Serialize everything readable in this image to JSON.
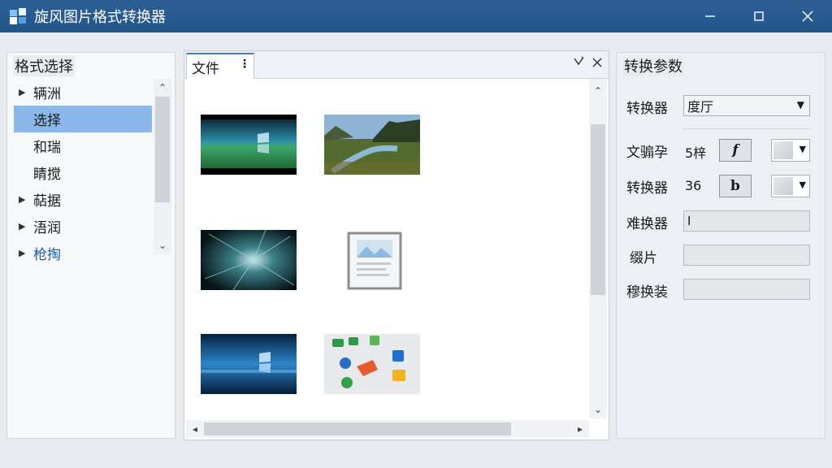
{
  "window": {
    "title": "旋风图片格式转换器",
    "controls": [
      "minimize",
      "maximize",
      "close"
    ]
  },
  "left_panel": {
    "title": "格式选择",
    "items": [
      {
        "label": "辆洲",
        "expandable": true,
        "selected": false,
        "link": false
      },
      {
        "label": "选择",
        "expandable": false,
        "selected": true,
        "link": false
      },
      {
        "label": "和瑞",
        "expandable": false,
        "selected": false,
        "link": false
      },
      {
        "label": "睛搅",
        "expandable": false,
        "selected": false,
        "link": false
      },
      {
        "label": "萜据",
        "expandable": true,
        "selected": false,
        "link": false
      },
      {
        "label": "浯润",
        "expandable": true,
        "selected": false,
        "link": false
      },
      {
        "label": "枪掏",
        "expandable": true,
        "selected": false,
        "link": true
      }
    ]
  },
  "center_panel": {
    "tab_label": "文件",
    "tab_menu": "⋮",
    "thumbnails": [
      {
        "name": "windows-wallpaper-green"
      },
      {
        "name": "landscape-river"
      },
      {
        "name": "abstract-burst"
      },
      {
        "name": "image-placeholder"
      },
      {
        "name": "windows-wallpaper-blue"
      },
      {
        "name": "colorful-icons"
      }
    ]
  },
  "right_panel": {
    "title": "转换参数",
    "converter": {
      "label": "转换器",
      "value": "度厅"
    },
    "row_text": {
      "label": "文骟孕",
      "value": "5梓",
      "button": "f"
    },
    "row_converter2": {
      "label": "转换器",
      "value": "36",
      "button": "b"
    },
    "row_input1": {
      "label": "难换器",
      "value": "I"
    },
    "row_input2": {
      "label": "缀片",
      "value": ""
    },
    "row_input3": {
      "label": "穆换装",
      "value": ""
    }
  },
  "colors": {
    "titlebar": "#2d5f95",
    "selection": "#8ab8ea",
    "link": "#1d5ea8",
    "tab_accent": "#3d7ec9"
  }
}
